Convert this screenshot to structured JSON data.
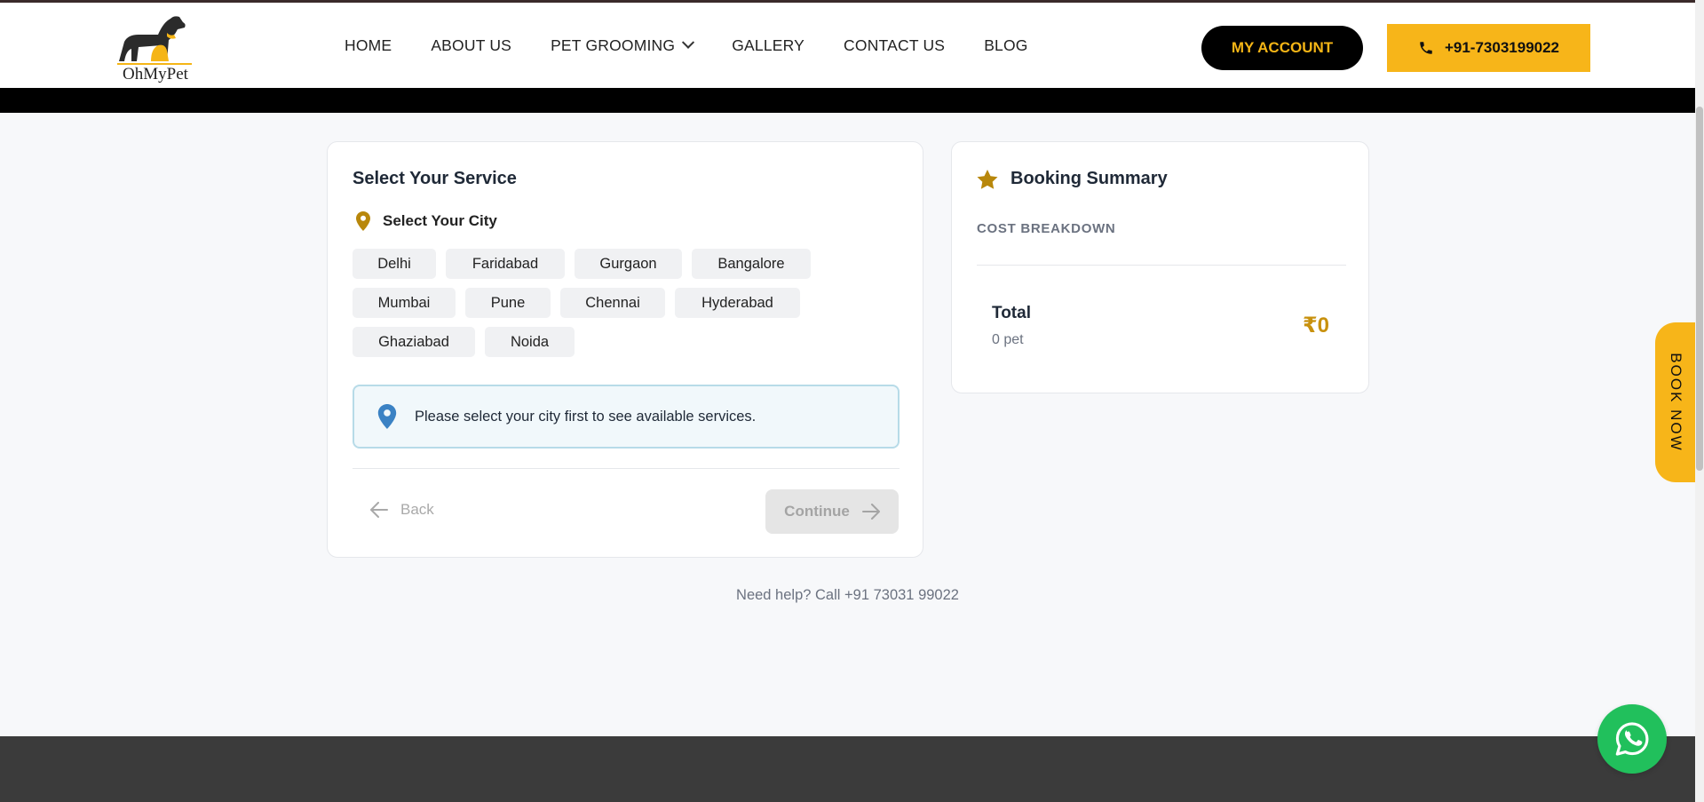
{
  "brand": {
    "logo_text": "OhMyPet",
    "accent": "#f7b519",
    "gold": "#c8910e"
  },
  "nav": {
    "items": [
      "HOME",
      "ABOUT US",
      "PET GROOMING",
      "GALLERY",
      "CONTACT US",
      "BLOG"
    ]
  },
  "header": {
    "account_label": "MY ACCOUNT",
    "phone_label": "+91-7303199022"
  },
  "service": {
    "title": "Select Your Service",
    "city_heading": "Select Your City",
    "cities": [
      "Delhi",
      "Faridabad",
      "Gurgaon",
      "Bangalore",
      "Mumbai",
      "Pune",
      "Chennai",
      "Hyderabad",
      "Ghaziabad",
      "Noida"
    ],
    "info": "Please select your city first to see available services.",
    "back_label": "Back",
    "continue_label": "Continue"
  },
  "summary": {
    "title": "Booking Summary",
    "cost_label": "COST BREAKDOWN",
    "total_label": "Total",
    "pets": "0 pet",
    "total_value": "₹0"
  },
  "help_text": "Need help? Call +91 73031 99022",
  "book_now": "BOOK NOW",
  "icons": [
    "dog-logo-icon",
    "chevron-down-icon",
    "phone-icon",
    "location-pin-icon",
    "arrow-left-icon",
    "arrow-right-icon",
    "star-icon",
    "whatsapp-icon"
  ]
}
